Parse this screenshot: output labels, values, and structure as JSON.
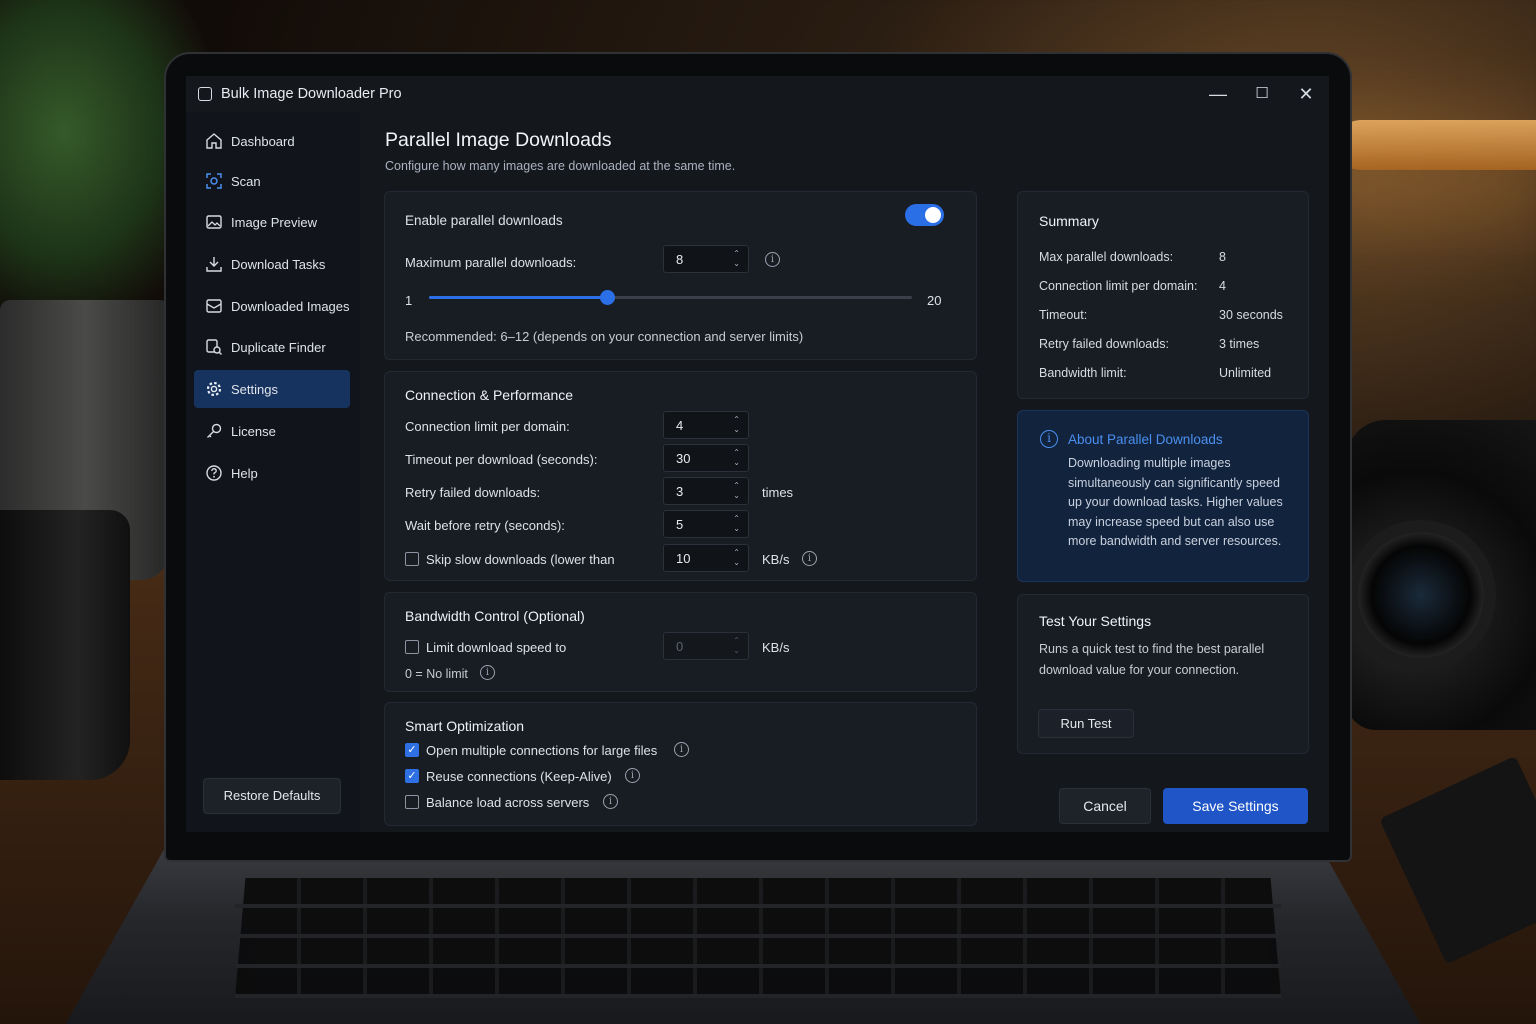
{
  "window": {
    "title": "Bulk Image Downloader Pro"
  },
  "sidebar": {
    "items": [
      {
        "label": "Dashboard",
        "icon": "home-icon",
        "active": false
      },
      {
        "label": "Scan",
        "icon": "scan-icon",
        "active": false
      },
      {
        "label": "Image Preview",
        "icon": "image-icon",
        "active": false
      },
      {
        "label": "Download Tasks",
        "icon": "download-icon",
        "active": false
      },
      {
        "label": "Downloaded Images",
        "icon": "inbox-icon",
        "active": false
      },
      {
        "label": "Duplicate Finder",
        "icon": "duplicate-icon",
        "active": false
      },
      {
        "label": "Settings",
        "icon": "gear-icon",
        "active": true
      },
      {
        "label": "License",
        "icon": "key-icon",
        "active": false
      },
      {
        "label": "Help",
        "icon": "help-icon",
        "active": false
      }
    ],
    "restore_label": "Restore Defaults"
  },
  "page": {
    "title": "Parallel Image Downloads",
    "subtitle": "Configure how many images are downloaded at the same time."
  },
  "parallel": {
    "enable_label": "Enable parallel downloads",
    "enabled": true,
    "max_label": "Maximum parallel downloads:",
    "max_value": "8",
    "slider_min": "1",
    "slider_max": "20",
    "slider_value": 8,
    "recommended": "Recommended: 6–12 (depends on your connection and server limits)"
  },
  "connection": {
    "title": "Connection & Performance",
    "limit_label": "Connection limit per domain:",
    "limit_value": "4",
    "timeout_label": "Timeout per download (seconds):",
    "timeout_value": "30",
    "retry_label": "Retry failed downloads:",
    "retry_value": "3",
    "retry_unit": "times",
    "wait_label": "Wait before retry (seconds):",
    "wait_value": "5",
    "skip_label": "Skip slow downloads (lower than",
    "skip_checked": false,
    "skip_value": "10",
    "skip_unit": "KB/s"
  },
  "bandwidth": {
    "title": "Bandwidth Control (Optional)",
    "limit_label": "Limit download speed to",
    "limit_checked": false,
    "limit_value": "0",
    "limit_unit": "KB/s",
    "note": "0 = No limit"
  },
  "smart": {
    "title": "Smart Optimization",
    "options": [
      {
        "label": "Open multiple connections for large files",
        "checked": true
      },
      {
        "label": "Reuse connections (Keep-Alive)",
        "checked": true
      },
      {
        "label": "Balance load across servers",
        "checked": false
      }
    ]
  },
  "summary": {
    "title": "Summary",
    "rows": [
      {
        "label": "Max parallel downloads:",
        "value": "8"
      },
      {
        "label": "Connection limit per domain:",
        "value": "4"
      },
      {
        "label": "Timeout:",
        "value": "30 seconds"
      },
      {
        "label": "Retry failed downloads:",
        "value": "3 times"
      },
      {
        "label": "Bandwidth limit:",
        "value": "Unlimited"
      }
    ]
  },
  "about": {
    "title": "About Parallel Downloads",
    "text": "Downloading multiple images simultaneously can significantly speed up your download tasks. Higher values may increase speed but can also use more bandwidth and server resources."
  },
  "test": {
    "title": "Test Your Settings",
    "text": "Runs a quick test to find the best parallel download value for your connection.",
    "button_label": "Run Test"
  },
  "footer": {
    "cancel_label": "Cancel",
    "save_label": "Save Settings"
  },
  "colors": {
    "accent": "#2b6fe6",
    "save_button": "#1f55c7",
    "sidebar_active": "#16325e",
    "about_bg": "#12233d"
  }
}
